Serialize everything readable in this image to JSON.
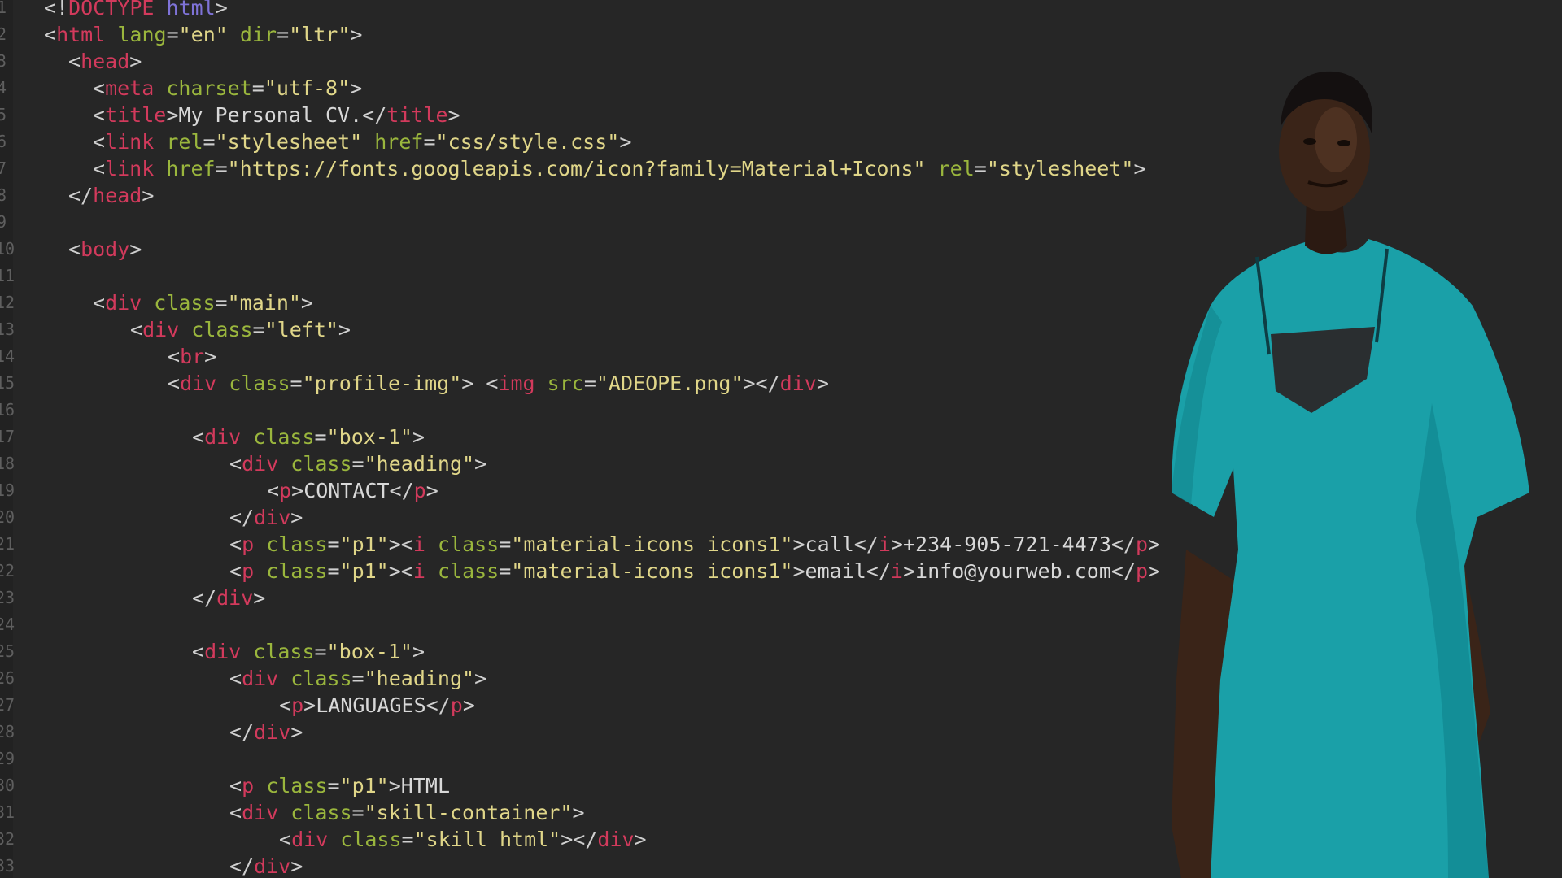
{
  "editor": {
    "lines": [
      {
        "n": "1",
        "indent": 54,
        "tokens": [
          {
            "c": "p",
            "v": "<!"
          },
          {
            "c": "t",
            "v": "DOCTYPE"
          },
          {
            "c": "p",
            "v": " "
          },
          {
            "c": "kw",
            "v": "html"
          },
          {
            "c": "p",
            "v": ">"
          }
        ]
      },
      {
        "n": "2",
        "indent": 54,
        "tokens": [
          {
            "c": "p",
            "v": "<"
          },
          {
            "c": "t",
            "v": "html"
          },
          {
            "c": "p",
            "v": " "
          },
          {
            "c": "a",
            "v": "lang"
          },
          {
            "c": "p",
            "v": "="
          },
          {
            "c": "s",
            "v": "\"en\""
          },
          {
            "c": "p",
            "v": " "
          },
          {
            "c": "a",
            "v": "dir"
          },
          {
            "c": "p",
            "v": "="
          },
          {
            "c": "s",
            "v": "\"ltr\""
          },
          {
            "c": "p",
            "v": ">"
          }
        ]
      },
      {
        "n": "3",
        "indent": 84,
        "tokens": [
          {
            "c": "p",
            "v": "<"
          },
          {
            "c": "t",
            "v": "head"
          },
          {
            "c": "p",
            "v": ">"
          }
        ]
      },
      {
        "n": "4",
        "indent": 114,
        "tokens": [
          {
            "c": "p",
            "v": "<"
          },
          {
            "c": "t",
            "v": "meta"
          },
          {
            "c": "p",
            "v": " "
          },
          {
            "c": "a",
            "v": "charset"
          },
          {
            "c": "p",
            "v": "="
          },
          {
            "c": "s",
            "v": "\"utf-8\""
          },
          {
            "c": "p",
            "v": ">"
          }
        ]
      },
      {
        "n": "5",
        "indent": 114,
        "tokens": [
          {
            "c": "p",
            "v": "<"
          },
          {
            "c": "t",
            "v": "title"
          },
          {
            "c": "p",
            "v": ">"
          },
          {
            "c": "x",
            "v": "My Personal CV."
          },
          {
            "c": "p",
            "v": "</"
          },
          {
            "c": "t",
            "v": "title"
          },
          {
            "c": "p",
            "v": ">"
          }
        ]
      },
      {
        "n": "6",
        "indent": 114,
        "tokens": [
          {
            "c": "p",
            "v": "<"
          },
          {
            "c": "t",
            "v": "link"
          },
          {
            "c": "p",
            "v": " "
          },
          {
            "c": "a",
            "v": "rel"
          },
          {
            "c": "p",
            "v": "="
          },
          {
            "c": "s",
            "v": "\"stylesheet\""
          },
          {
            "c": "p",
            "v": " "
          },
          {
            "c": "a",
            "v": "href"
          },
          {
            "c": "p",
            "v": "="
          },
          {
            "c": "s",
            "v": "\"css/style.css\""
          },
          {
            "c": "p",
            "v": ">"
          }
        ]
      },
      {
        "n": "7",
        "indent": 114,
        "tokens": [
          {
            "c": "p",
            "v": "<"
          },
          {
            "c": "t",
            "v": "link"
          },
          {
            "c": "p",
            "v": " "
          },
          {
            "c": "a",
            "v": "href"
          },
          {
            "c": "p",
            "v": "="
          },
          {
            "c": "s",
            "v": "\"https://fonts.googleapis.com/icon?family=Material+Icons\""
          },
          {
            "c": "p",
            "v": " "
          },
          {
            "c": "a",
            "v": "rel"
          },
          {
            "c": "p",
            "v": "="
          },
          {
            "c": "s",
            "v": "\"stylesheet\""
          },
          {
            "c": "p",
            "v": ">"
          }
        ]
      },
      {
        "n": "8",
        "indent": 84,
        "tokens": [
          {
            "c": "p",
            "v": "</"
          },
          {
            "c": "t",
            "v": "head"
          },
          {
            "c": "p",
            "v": ">"
          }
        ]
      },
      {
        "n": "9",
        "indent": 84,
        "tokens": []
      },
      {
        "n": "10",
        "indent": 84,
        "tokens": [
          {
            "c": "p",
            "v": "<"
          },
          {
            "c": "t",
            "v": "body"
          },
          {
            "c": "p",
            "v": ">"
          }
        ]
      },
      {
        "n": "11",
        "indent": 84,
        "tokens": []
      },
      {
        "n": "12",
        "indent": 114,
        "tokens": [
          {
            "c": "p",
            "v": "<"
          },
          {
            "c": "t",
            "v": "div"
          },
          {
            "c": "p",
            "v": " "
          },
          {
            "c": "a",
            "v": "class"
          },
          {
            "c": "p",
            "v": "="
          },
          {
            "c": "s",
            "v": "\"main\""
          },
          {
            "c": "p",
            "v": ">"
          }
        ]
      },
      {
        "n": "13",
        "indent": 160,
        "tokens": [
          {
            "c": "p",
            "v": "<"
          },
          {
            "c": "t",
            "v": "div"
          },
          {
            "c": "p",
            "v": " "
          },
          {
            "c": "a",
            "v": "class"
          },
          {
            "c": "p",
            "v": "="
          },
          {
            "c": "s",
            "v": "\"left\""
          },
          {
            "c": "p",
            "v": ">"
          }
        ]
      },
      {
        "n": "14",
        "indent": 206,
        "tokens": [
          {
            "c": "p",
            "v": "<"
          },
          {
            "c": "t",
            "v": "br"
          },
          {
            "c": "p",
            "v": ">"
          }
        ]
      },
      {
        "n": "15",
        "indent": 206,
        "tokens": [
          {
            "c": "p",
            "v": "<"
          },
          {
            "c": "t",
            "v": "div"
          },
          {
            "c": "p",
            "v": " "
          },
          {
            "c": "a",
            "v": "class"
          },
          {
            "c": "p",
            "v": "="
          },
          {
            "c": "s",
            "v": "\"profile-img\""
          },
          {
            "c": "p",
            "v": "> <"
          },
          {
            "c": "t",
            "v": "img"
          },
          {
            "c": "p",
            "v": " "
          },
          {
            "c": "a",
            "v": "src"
          },
          {
            "c": "p",
            "v": "="
          },
          {
            "c": "s",
            "v": "\"ADEOPE.png\""
          },
          {
            "c": "p",
            "v": "></"
          },
          {
            "c": "t",
            "v": "div"
          },
          {
            "c": "p",
            "v": ">"
          }
        ]
      },
      {
        "n": "16",
        "indent": 206,
        "tokens": []
      },
      {
        "n": "17",
        "indent": 236,
        "tokens": [
          {
            "c": "p",
            "v": "<"
          },
          {
            "c": "t",
            "v": "div"
          },
          {
            "c": "p",
            "v": " "
          },
          {
            "c": "a",
            "v": "class"
          },
          {
            "c": "p",
            "v": "="
          },
          {
            "c": "s",
            "v": "\"box-1\""
          },
          {
            "c": "p",
            "v": ">"
          }
        ]
      },
      {
        "n": "18",
        "indent": 282,
        "tokens": [
          {
            "c": "p",
            "v": "<"
          },
          {
            "c": "t",
            "v": "div"
          },
          {
            "c": "p",
            "v": " "
          },
          {
            "c": "a",
            "v": "class"
          },
          {
            "c": "p",
            "v": "="
          },
          {
            "c": "s",
            "v": "\"heading\""
          },
          {
            "c": "p",
            "v": ">"
          }
        ]
      },
      {
        "n": "19",
        "indent": 328,
        "tokens": [
          {
            "c": "p",
            "v": "<"
          },
          {
            "c": "t",
            "v": "p"
          },
          {
            "c": "p",
            "v": ">"
          },
          {
            "c": "x",
            "v": "CONTACT"
          },
          {
            "c": "p",
            "v": "</"
          },
          {
            "c": "t",
            "v": "p"
          },
          {
            "c": "p",
            "v": ">"
          }
        ]
      },
      {
        "n": "20",
        "indent": 282,
        "tokens": [
          {
            "c": "p",
            "v": "</"
          },
          {
            "c": "t",
            "v": "div"
          },
          {
            "c": "p",
            "v": ">"
          }
        ]
      },
      {
        "n": "21",
        "indent": 282,
        "tokens": [
          {
            "c": "p",
            "v": "<"
          },
          {
            "c": "t",
            "v": "p"
          },
          {
            "c": "p",
            "v": " "
          },
          {
            "c": "a",
            "v": "class"
          },
          {
            "c": "p",
            "v": "="
          },
          {
            "c": "s",
            "v": "\"p1\""
          },
          {
            "c": "p",
            "v": "><"
          },
          {
            "c": "t",
            "v": "i"
          },
          {
            "c": "p",
            "v": " "
          },
          {
            "c": "a",
            "v": "class"
          },
          {
            "c": "p",
            "v": "="
          },
          {
            "c": "s",
            "v": "\"material-icons icons1\""
          },
          {
            "c": "p",
            "v": ">"
          },
          {
            "c": "x",
            "v": "call"
          },
          {
            "c": "p",
            "v": "</"
          },
          {
            "c": "t",
            "v": "i"
          },
          {
            "c": "p",
            "v": ">"
          },
          {
            "c": "x",
            "v": "+234-905-721-4473"
          },
          {
            "c": "p",
            "v": "</"
          },
          {
            "c": "t",
            "v": "p"
          },
          {
            "c": "p",
            "v": ">"
          }
        ]
      },
      {
        "n": "22",
        "indent": 282,
        "tokens": [
          {
            "c": "p",
            "v": "<"
          },
          {
            "c": "t",
            "v": "p"
          },
          {
            "c": "p",
            "v": " "
          },
          {
            "c": "a",
            "v": "class"
          },
          {
            "c": "p",
            "v": "="
          },
          {
            "c": "s",
            "v": "\"p1\""
          },
          {
            "c": "p",
            "v": "><"
          },
          {
            "c": "t",
            "v": "i"
          },
          {
            "c": "p",
            "v": " "
          },
          {
            "c": "a",
            "v": "class"
          },
          {
            "c": "p",
            "v": "="
          },
          {
            "c": "s",
            "v": "\"material-icons icons1\""
          },
          {
            "c": "p",
            "v": ">"
          },
          {
            "c": "x",
            "v": "email"
          },
          {
            "c": "p",
            "v": "</"
          },
          {
            "c": "t",
            "v": "i"
          },
          {
            "c": "p",
            "v": ">"
          },
          {
            "c": "x",
            "v": "info@yourweb.com"
          },
          {
            "c": "p",
            "v": "</"
          },
          {
            "c": "t",
            "v": "p"
          },
          {
            "c": "p",
            "v": ">"
          }
        ]
      },
      {
        "n": "23",
        "indent": 236,
        "tokens": [
          {
            "c": "p",
            "v": "</"
          },
          {
            "c": "t",
            "v": "div"
          },
          {
            "c": "p",
            "v": ">"
          }
        ]
      },
      {
        "n": "24",
        "indent": 236,
        "tokens": []
      },
      {
        "n": "25",
        "indent": 236,
        "tokens": [
          {
            "c": "p",
            "v": "<"
          },
          {
            "c": "t",
            "v": "div"
          },
          {
            "c": "p",
            "v": " "
          },
          {
            "c": "a",
            "v": "class"
          },
          {
            "c": "p",
            "v": "="
          },
          {
            "c": "s",
            "v": "\"box-1\""
          },
          {
            "c": "p",
            "v": ">"
          }
        ]
      },
      {
        "n": "26",
        "indent": 282,
        "tokens": [
          {
            "c": "p",
            "v": "<"
          },
          {
            "c": "t",
            "v": "div"
          },
          {
            "c": "p",
            "v": " "
          },
          {
            "c": "a",
            "v": "class"
          },
          {
            "c": "p",
            "v": "="
          },
          {
            "c": "s",
            "v": "\"heading\""
          },
          {
            "c": "p",
            "v": ">"
          }
        ]
      },
      {
        "n": "27",
        "indent": 343,
        "tokens": [
          {
            "c": "p",
            "v": "<"
          },
          {
            "c": "t",
            "v": "p"
          },
          {
            "c": "p",
            "v": ">"
          },
          {
            "c": "x",
            "v": "LANGUAGES"
          },
          {
            "c": "p",
            "v": "</"
          },
          {
            "c": "t",
            "v": "p"
          },
          {
            "c": "p",
            "v": ">"
          }
        ]
      },
      {
        "n": "28",
        "indent": 282,
        "tokens": [
          {
            "c": "p",
            "v": "</"
          },
          {
            "c": "t",
            "v": "div"
          },
          {
            "c": "p",
            "v": ">"
          }
        ]
      },
      {
        "n": "29",
        "indent": 282,
        "tokens": []
      },
      {
        "n": "30",
        "indent": 282,
        "tokens": [
          {
            "c": "p",
            "v": "<"
          },
          {
            "c": "t",
            "v": "p"
          },
          {
            "c": "p",
            "v": " "
          },
          {
            "c": "a",
            "v": "class"
          },
          {
            "c": "p",
            "v": "="
          },
          {
            "c": "s",
            "v": "\"p1\""
          },
          {
            "c": "p",
            "v": ">"
          },
          {
            "c": "x",
            "v": "HTML"
          }
        ]
      },
      {
        "n": "31",
        "indent": 282,
        "tokens": [
          {
            "c": "p",
            "v": "<"
          },
          {
            "c": "t",
            "v": "div"
          },
          {
            "c": "p",
            "v": " "
          },
          {
            "c": "a",
            "v": "class"
          },
          {
            "c": "p",
            "v": "="
          },
          {
            "c": "s",
            "v": "\"skill-container\""
          },
          {
            "c": "p",
            "v": ">"
          }
        ]
      },
      {
        "n": "32",
        "indent": 343,
        "tokens": [
          {
            "c": "p",
            "v": "<"
          },
          {
            "c": "t",
            "v": "div"
          },
          {
            "c": "p",
            "v": " "
          },
          {
            "c": "a",
            "v": "class"
          },
          {
            "c": "p",
            "v": "="
          },
          {
            "c": "s",
            "v": "\"skill html\""
          },
          {
            "c": "p",
            "v": "></"
          },
          {
            "c": "t",
            "v": "div"
          },
          {
            "c": "p",
            "v": ">"
          }
        ]
      },
      {
        "n": "33",
        "indent": 282,
        "tokens": [
          {
            "c": "p",
            "v": "</"
          },
          {
            "c": "t",
            "v": "div"
          },
          {
            "c": "p",
            "v": ">"
          }
        ]
      }
    ]
  },
  "photo": {
    "subject": "portrait-of-man-in-teal-kaftan",
    "colors": {
      "shirt": "#1aa0a8",
      "shirt_shadow": "#0f7f88",
      "skin": "#3a2418",
      "skin_light": "#5a3a28",
      "neck_panel": "#2a2e30"
    }
  }
}
